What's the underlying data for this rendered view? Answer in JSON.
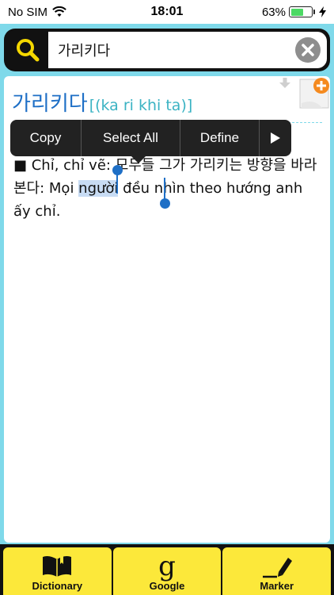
{
  "status_bar": {
    "carrier": "No SIM",
    "time": "18:01",
    "battery_percent": "63%",
    "battery_level": 0.63
  },
  "search": {
    "query": "가리키다"
  },
  "entry": {
    "headword": "가리키다",
    "pronunciation": "[(ka ri khi ta)]",
    "definition_prefix": "■ Chỉ, chỉ vẽ: 모두들 그가 가리키는 방향을 바라본다: Mọi ",
    "definition_selected": "người",
    "definition_suffix": " đều nhìn theo hướng anh ấy chỉ."
  },
  "context_menu": {
    "items": [
      "Copy",
      "Select All",
      "Define"
    ],
    "more_icon": "play-triangle-icon"
  },
  "toolbar": {
    "dictionary_label": "Dictionary",
    "google_label": "Google",
    "google_glyph": "g",
    "marker_label": "Marker"
  },
  "colors": {
    "background": "#7fd9ea",
    "headword": "#1e6fc6",
    "pronunciation": "#3bb3c3",
    "toolbar_button": "#fce83a",
    "search_icon": "#f5d800",
    "add_badge": "#f58a1f"
  }
}
